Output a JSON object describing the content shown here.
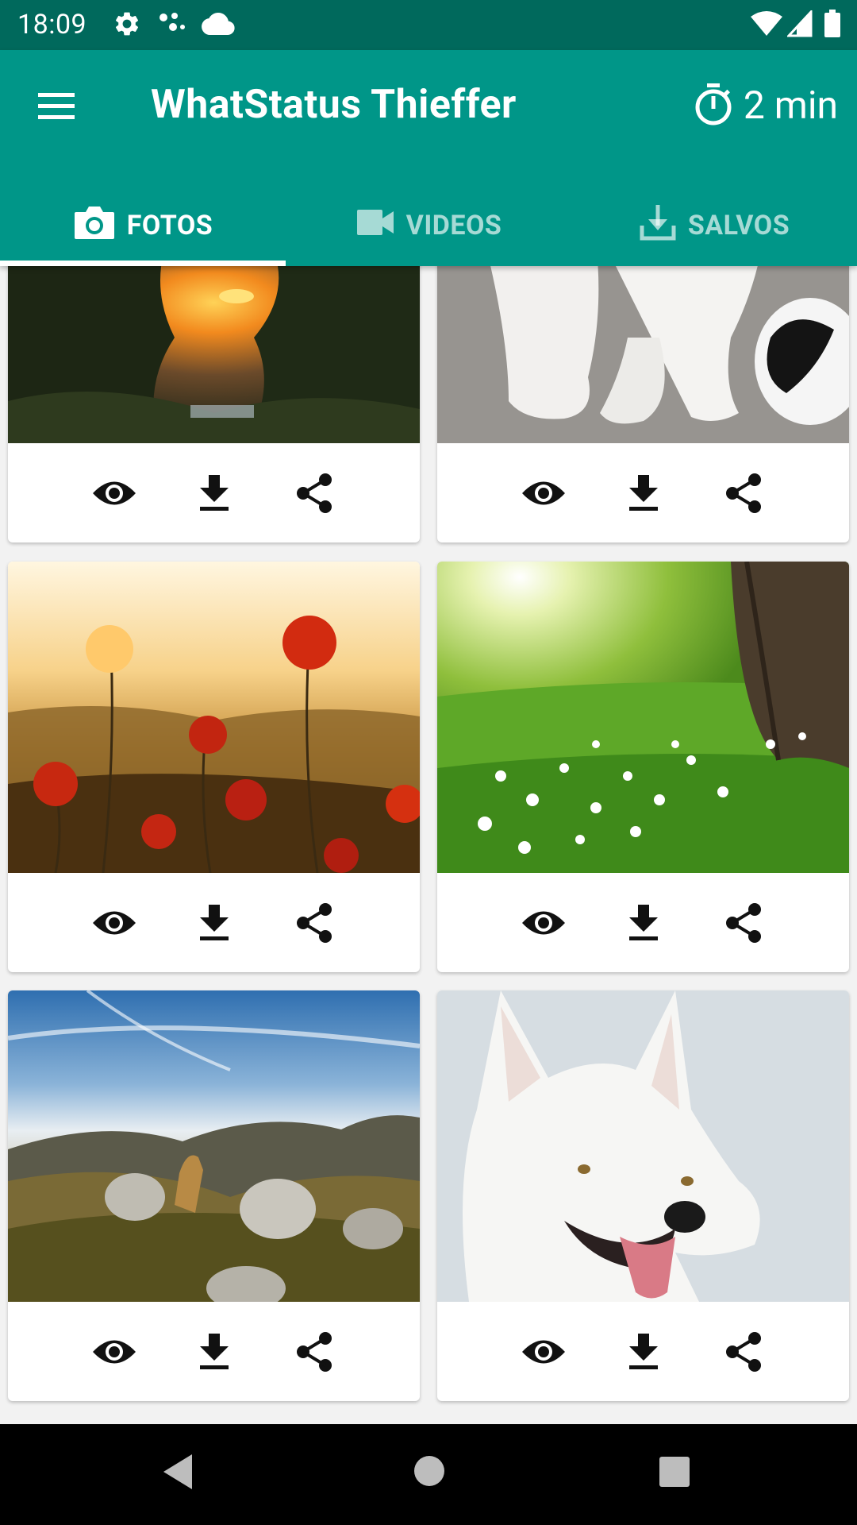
{
  "status_bar": {
    "time": "18:09",
    "left_icons": [
      "settings-icon",
      "assistant-dots-icon",
      "cloud-icon"
    ],
    "right_icons": [
      "wifi-icon",
      "signal-icon",
      "battery-icon"
    ]
  },
  "app_bar": {
    "title": "WhatStatus Thieffer",
    "menu_icon": "hamburger-menu-icon",
    "timer_icon": "stopwatch-icon",
    "timer_label": "2 min"
  },
  "tabs": [
    {
      "label": "FOTOS",
      "icon": "camera-icon",
      "active": true
    },
    {
      "label": "VIDEOS",
      "icon": "videocam-icon",
      "active": false
    },
    {
      "label": "SALVOS",
      "icon": "download-tray-icon",
      "active": false
    }
  ],
  "photos": [
    {
      "subject": "sunset-trees",
      "actions": [
        "view-icon",
        "download-icon",
        "share-icon"
      ]
    },
    {
      "subject": "puppy-paws",
      "actions": [
        "view-icon",
        "download-icon",
        "share-icon"
      ]
    },
    {
      "subject": "poppies-sunset",
      "actions": [
        "view-icon",
        "download-icon",
        "share-icon"
      ]
    },
    {
      "subject": "meadow-tree",
      "actions": [
        "view-icon",
        "download-icon",
        "share-icon"
      ]
    },
    {
      "subject": "dog-mountains",
      "actions": [
        "view-icon",
        "download-icon",
        "share-icon"
      ]
    },
    {
      "subject": "white-shepherd",
      "actions": [
        "view-icon",
        "download-icon",
        "share-icon"
      ]
    }
  ],
  "colors": {
    "status_bar": "#00695c",
    "app_bar": "#009688",
    "background": "#f2f2f2",
    "icon": "#111111"
  },
  "nav_bar": [
    "back-icon",
    "home-icon",
    "recents-icon"
  ]
}
